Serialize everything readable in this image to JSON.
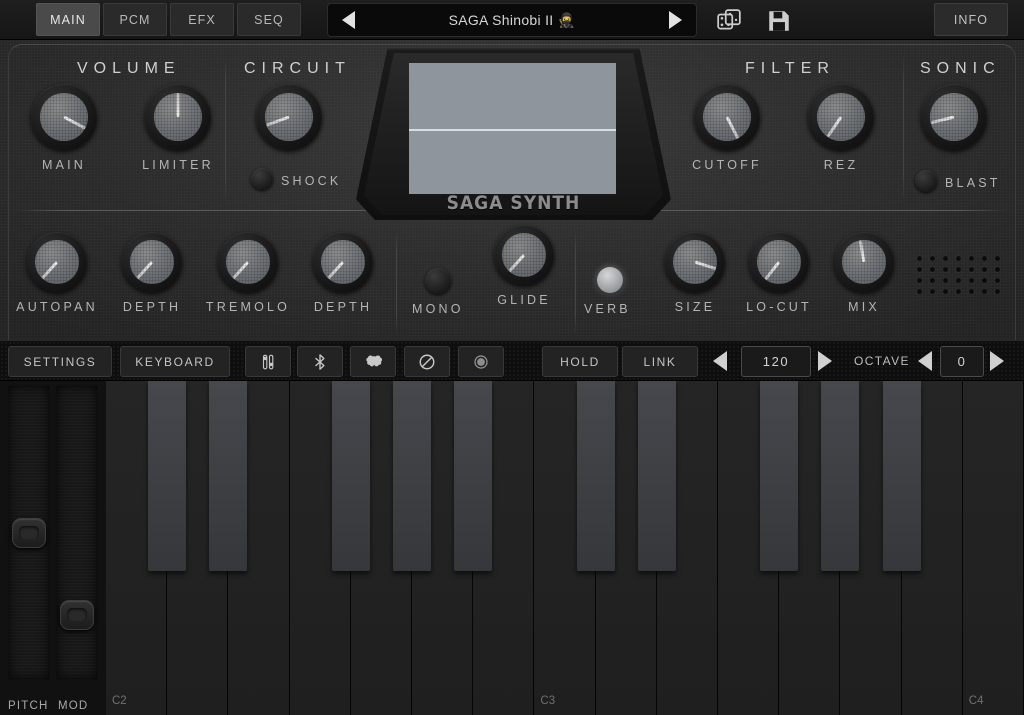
{
  "toolbar": {
    "tabs": [
      {
        "label": "MAIN",
        "active": true
      },
      {
        "label": "PCM",
        "active": false
      },
      {
        "label": "EFX",
        "active": false
      },
      {
        "label": "SEQ",
        "active": false
      }
    ],
    "preset": {
      "name": "SAGA Shinobi II 🥷",
      "prev_icon": "arrow-left-icon",
      "next_icon": "arrow-right-icon"
    },
    "randomize_icon": "dice-icon",
    "save_icon": "floppy-disk-icon",
    "info_label": "INFO"
  },
  "panel": {
    "sections": [
      {
        "title": "VOLUME"
      },
      {
        "title": "CIRCUIT"
      },
      {
        "title": "FILTER"
      },
      {
        "title": "SONIC"
      }
    ],
    "knobs_row1": [
      {
        "label": "MAIN",
        "angle": 118
      },
      {
        "label": "LIMITER",
        "angle": 0
      },
      {
        "label": "CUTOFF",
        "angle": 153
      },
      {
        "label": "REZ",
        "angle": -146
      },
      {
        "label": "CIRCUIT_KNOB",
        "angle": -110
      }
    ],
    "knob_main": {
      "label": "MAIN",
      "angle": 118
    },
    "knob_limiter": {
      "label": "LIMITER",
      "angle": 0
    },
    "knob_circuit": {
      "label": "",
      "angle": -110
    },
    "knob_cutoff": {
      "label": "CUTOFF",
      "angle": 153
    },
    "knob_rez": {
      "label": "REZ",
      "angle": -146
    },
    "knob_sonic": {
      "label": "",
      "angle": -104
    },
    "led_shock": {
      "label": "SHOCK",
      "on": false
    },
    "led_blast": {
      "label": "BLAST",
      "on": false
    },
    "display": {
      "brand": "SAGA SYNTH"
    },
    "knob_autopan": {
      "label": "AUTOPAN",
      "angle": -138
    },
    "knob_ap_depth": {
      "label": "DEPTH",
      "angle": -138
    },
    "knob_tremolo": {
      "label": "TREMOLO",
      "angle": -138
    },
    "knob_tr_depth": {
      "label": "DEPTH",
      "angle": -138
    },
    "knob_glide": {
      "label": "GLIDE",
      "angle": -138
    },
    "knob_size": {
      "label": "SIZE",
      "angle": 108
    },
    "knob_locut": {
      "label": "LO-CUT",
      "angle": -142
    },
    "knob_mix": {
      "label": "MIX",
      "angle": -10
    },
    "led_mono": {
      "label": "MONO",
      "on": false
    },
    "led_verb": {
      "label": "VERB",
      "on": true
    },
    "grille_icon": "speaker-grille-icon"
  },
  "strip": {
    "settings_label": "SETTINGS",
    "keyboard_label": "KEYBOARD",
    "icons": [
      {
        "name": "faders-icon"
      },
      {
        "name": "bluetooth-icon"
      },
      {
        "name": "brain-icon"
      },
      {
        "name": "panic-icon"
      },
      {
        "name": "record-icon"
      }
    ],
    "hold_label": "HOLD",
    "link_label": "LINK",
    "tempo_value": "120",
    "tempo_dec_icon": "spinner-left-icon",
    "tempo_inc_icon": "spinner-right-icon",
    "octave_label": "OCTAVE",
    "octave_value": "0",
    "octave_dec_icon": "spinner-left-icon",
    "octave_inc_icon": "spinner-right-icon"
  },
  "keyboard": {
    "pitch_label": "PITCH",
    "mod_label": "MOD",
    "pitch_position": 0.5,
    "mod_position": 0.82,
    "octave_labels": [
      "C2",
      "C3",
      "C4"
    ],
    "white_key_count": 15,
    "black_key_pattern": [
      1,
      1,
      0,
      1,
      1,
      1,
      0
    ]
  }
}
